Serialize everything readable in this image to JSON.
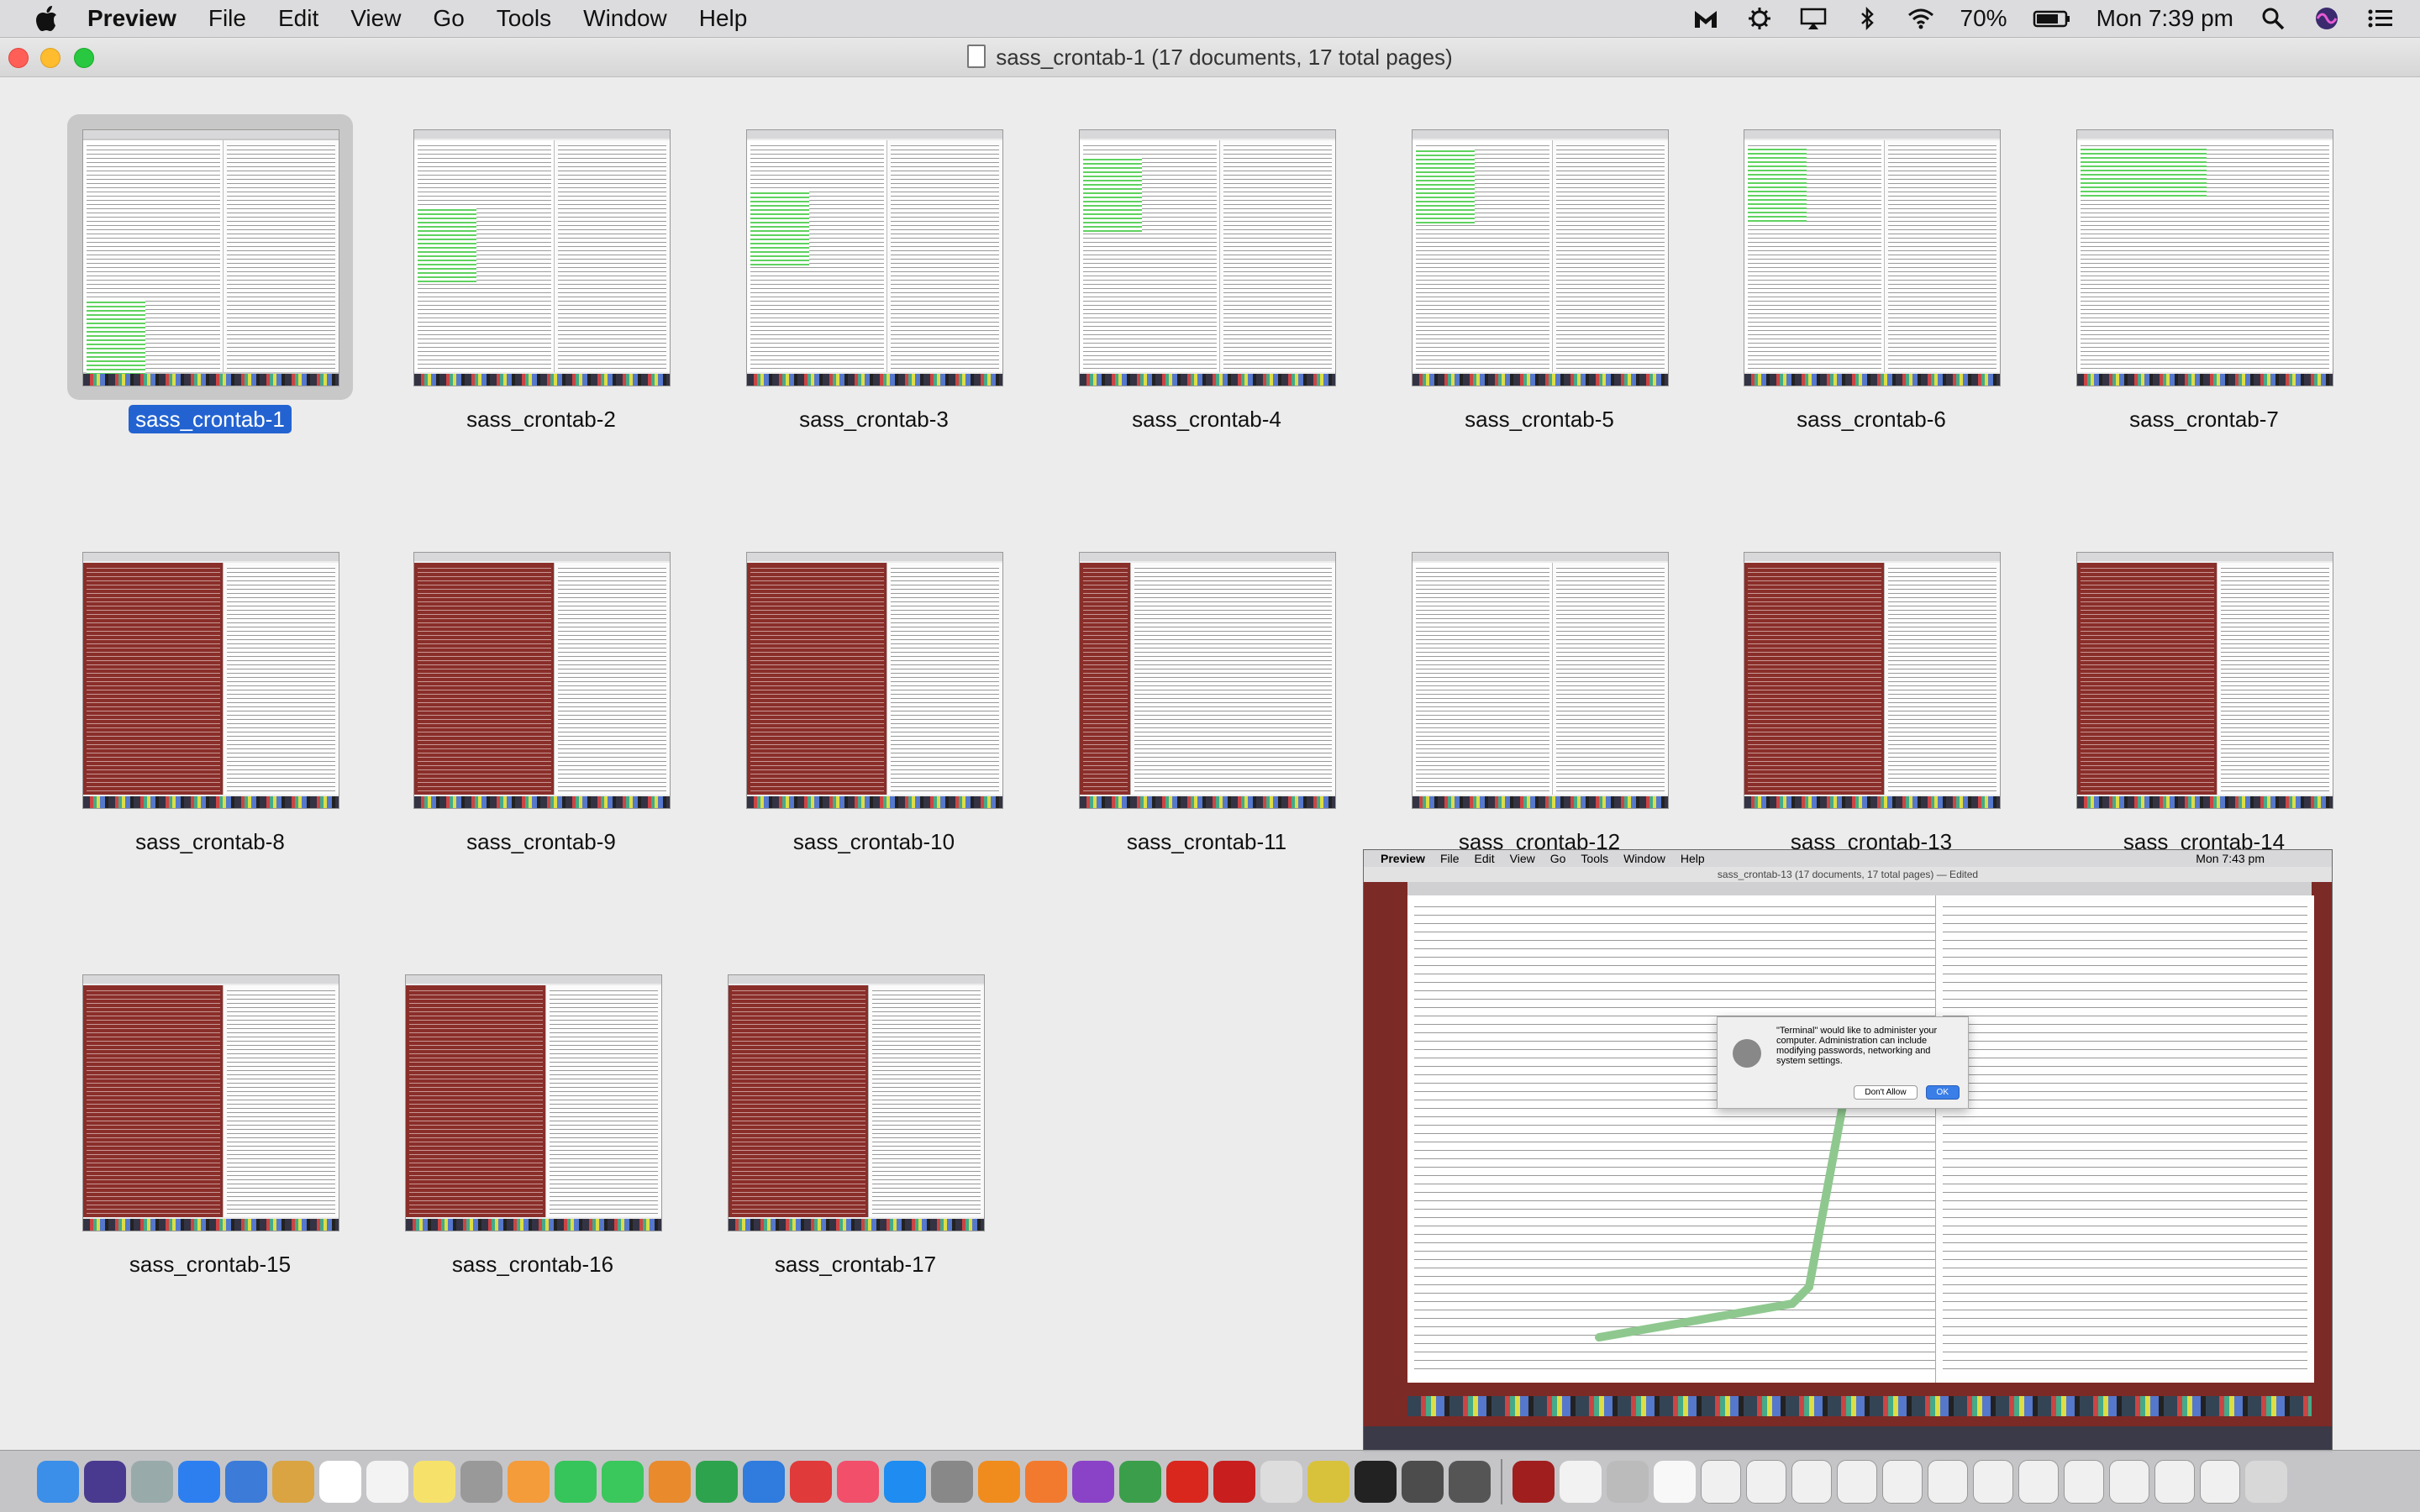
{
  "menubar": {
    "app": "Preview",
    "menus": [
      "File",
      "Edit",
      "View",
      "Go",
      "Tools",
      "Window",
      "Help"
    ],
    "battery": "70%",
    "clock": "Mon 7:39 pm"
  },
  "window": {
    "title": "sass_crontab-1 (17 documents, 17 total pages)"
  },
  "thumbnails": [
    {
      "label": "sass_crontab-1",
      "selected": true
    },
    {
      "label": "sass_crontab-2"
    },
    {
      "label": "sass_crontab-3"
    },
    {
      "label": "sass_crontab-4"
    },
    {
      "label": "sass_crontab-5"
    },
    {
      "label": "sass_crontab-6"
    },
    {
      "label": "sass_crontab-7"
    },
    {
      "label": "sass_crontab-8"
    },
    {
      "label": "sass_crontab-9"
    },
    {
      "label": "sass_crontab-10"
    },
    {
      "label": "sass_crontab-11"
    },
    {
      "label": "sass_crontab-12"
    },
    {
      "label": "sass_crontab-13"
    },
    {
      "label": "sass_crontab-14"
    },
    {
      "label": "sass_crontab-15"
    },
    {
      "label": "sass_crontab-16"
    },
    {
      "label": "sass_crontab-17"
    }
  ],
  "quicklook": {
    "menubar": [
      "Preview",
      "File",
      "Edit",
      "View",
      "Go",
      "Tools",
      "Window",
      "Help"
    ],
    "clock": "Mon 7:43 pm",
    "title": "sass_crontab-13 (17 documents, 17 total pages) — Edited",
    "dialog_text": "\"Terminal\" would like to administer your computer. Administration can include modifying passwords, networking and system settings.",
    "dialog_deny": "Don't Allow",
    "dialog_ok": "OK"
  },
  "dock_icons": [
    "finder-icon",
    "siri-icon",
    "launchpad-icon",
    "safari-icon",
    "preview-icon",
    "notes-icon",
    "calendar-icon",
    "textedit-icon",
    "stickies-icon",
    "script-editor-icon",
    "photos-icon",
    "messages-icon",
    "facetime-icon",
    "books-icon",
    "numbers-icon",
    "keynote-icon",
    "blocker-icon",
    "music-icon",
    "app-store-icon",
    "system-prefs-icon",
    "vlc-icon",
    "firefox-icon",
    "phpstorm-icon",
    "chrome-icon",
    "opera-icon",
    "filezilla-icon",
    "gimp-icon",
    "cyberduck-icon",
    "terminal-icon",
    "python-icon",
    "utilities-icon",
    "vpn-icon",
    "atom-icon",
    "image-icon",
    "document-icon"
  ]
}
